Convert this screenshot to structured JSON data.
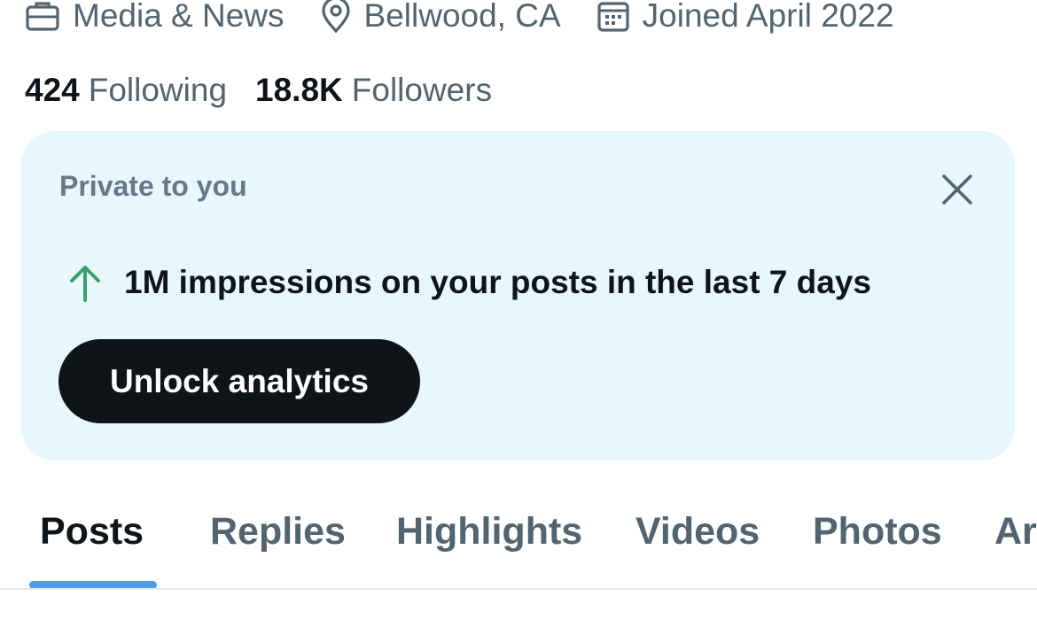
{
  "profile_meta": {
    "category": "Media & News",
    "location": "Bellwood, CA",
    "joined": "Joined April 2022",
    "icons": [
      "briefcase-icon",
      "location-pin-icon",
      "calendar-icon"
    ]
  },
  "follow_stats": {
    "following_count": "424",
    "following_label": "Following",
    "followers_count": "18.8K",
    "followers_label": "Followers"
  },
  "private_card": {
    "title": "Private to you",
    "impressions_text": "1M impressions on your posts in the last 7 days",
    "button_label": "Unlock analytics",
    "icons": [
      "close-icon",
      "arrow-up-icon"
    ]
  },
  "tabs": [
    {
      "label": "Posts",
      "active": true
    },
    {
      "label": "Replies",
      "active": false
    },
    {
      "label": "Highlights",
      "active": false
    },
    {
      "label": "Videos",
      "active": false
    },
    {
      "label": "Photos",
      "active": false
    },
    {
      "label": "Articles",
      "active": false
    }
  ],
  "colors": {
    "card_background": "#e8f7fd",
    "accent_blue": "#4c9de8",
    "growth_green": "#3aa06a",
    "button_dark": "#0f1419",
    "muted_text": "#536471"
  }
}
